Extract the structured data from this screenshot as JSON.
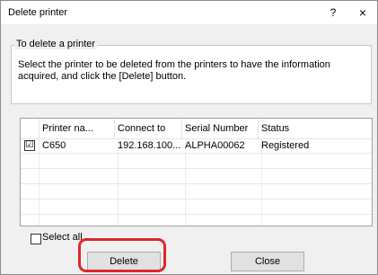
{
  "window": {
    "title": "Delete printer",
    "help_label": "?",
    "close_label": "×"
  },
  "group": {
    "legend": "To delete a printer",
    "instructions": "Select the printer to be deleted from the printers to have the information acquired, and click the [Delete] button."
  },
  "table": {
    "columns": [
      "Printer na...",
      "Connect to",
      "Serial Number",
      "Status"
    ],
    "rows": [
      {
        "checked": "☑",
        "cells": [
          "C650",
          "192.168.100...",
          "ALPHA00062",
          "Registered"
        ]
      }
    ]
  },
  "select_all": {
    "label": "Select all"
  },
  "buttons": {
    "delete": "Delete",
    "close": "Close"
  },
  "colors": {
    "highlight": "#e0262a",
    "dialog_bg": "#f0f0f0"
  }
}
